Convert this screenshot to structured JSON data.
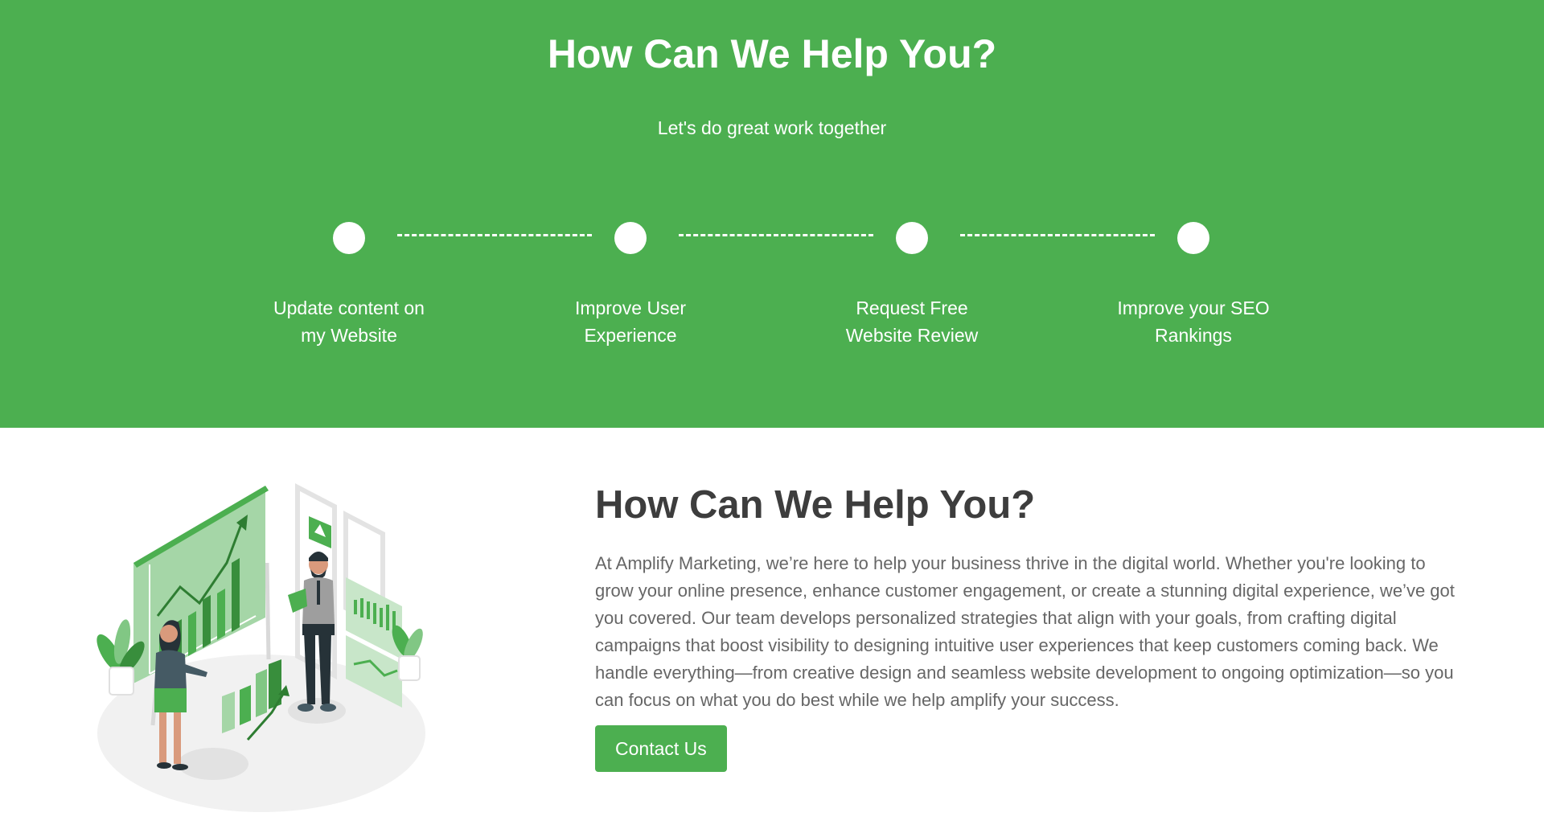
{
  "hero": {
    "title": "How Can We Help You?",
    "subtitle": "Let's do great work together",
    "background": "#4caf50",
    "steps": [
      {
        "line1": "Update content on",
        "line2": "my Website"
      },
      {
        "line1": "Improve User",
        "line2": "Experience"
      },
      {
        "line1": "Request Free",
        "line2": "Website Review"
      },
      {
        "line1": "Improve your SEO",
        "line2": "Rankings"
      }
    ]
  },
  "about": {
    "title": "How Can We Help You?",
    "text": "At Amplify Marketing, we’re here to help your business thrive in the digital world. Whether you're looking to grow your online presence, enhance customer engagement, or create a stunning digital experience, we’ve got you covered. Our team develops personalized strategies that align with your goals, from crafting digital campaigns that boost visibility to designing intuitive user experiences that keep customers coming back. We handle everything—from creative design and seamless website development to ongoing optimization—so you can focus on what you do best while we help amplify your success.",
    "button_label": "Contact Us",
    "illustration": "business-growth-chart-illustration"
  },
  "colors": {
    "accent": "#4caf50",
    "heading": "#3d3d3d",
    "body_text": "#666666"
  }
}
